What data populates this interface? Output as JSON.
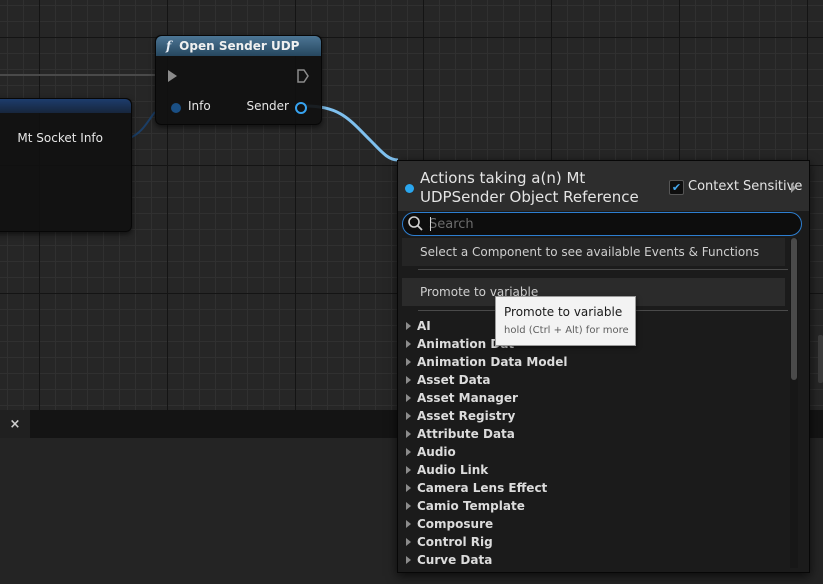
{
  "graph": {
    "socket_node": {
      "pin_label": "Mt Socket Info"
    },
    "open_node": {
      "title": "Open Sender UDP",
      "func_icon": "f",
      "input_pin_label": "Info",
      "output_pin_label": "Sender"
    }
  },
  "bottom_bar": {
    "close_glyph": "×"
  },
  "action_menu": {
    "title": "Actions taking a(n) Mt UDPSender Object Reference",
    "context_sensitive": {
      "label": "Context Sensitive",
      "checked": true
    },
    "search": {
      "placeholder": "Search",
      "value": ""
    },
    "info_row": "Select a Component to see available Events & Functions",
    "promote_row": "Promote to variable",
    "categories": [
      "AI",
      "Animation Dat",
      "Animation Data Model",
      "Asset Data",
      "Asset Manager",
      "Asset Registry",
      "Attribute Data",
      "Audio",
      "Audio Link",
      "Camera Lens Effect",
      "Camio Template",
      "Composure",
      "Control Rig",
      "Curve Data"
    ]
  },
  "tooltip": {
    "title": "Promote to variable",
    "hint": "hold (Ctrl + Alt) for more"
  },
  "colors": {
    "accent_blue": "#2aa6ee",
    "wire": "#7fc0ee",
    "node_header_function": "#3f6886"
  },
  "icons": [
    "function-icon",
    "exec-pin-icon",
    "search-icon",
    "checkbox-check-icon",
    "expand-arrow-icon",
    "close-icon"
  ]
}
